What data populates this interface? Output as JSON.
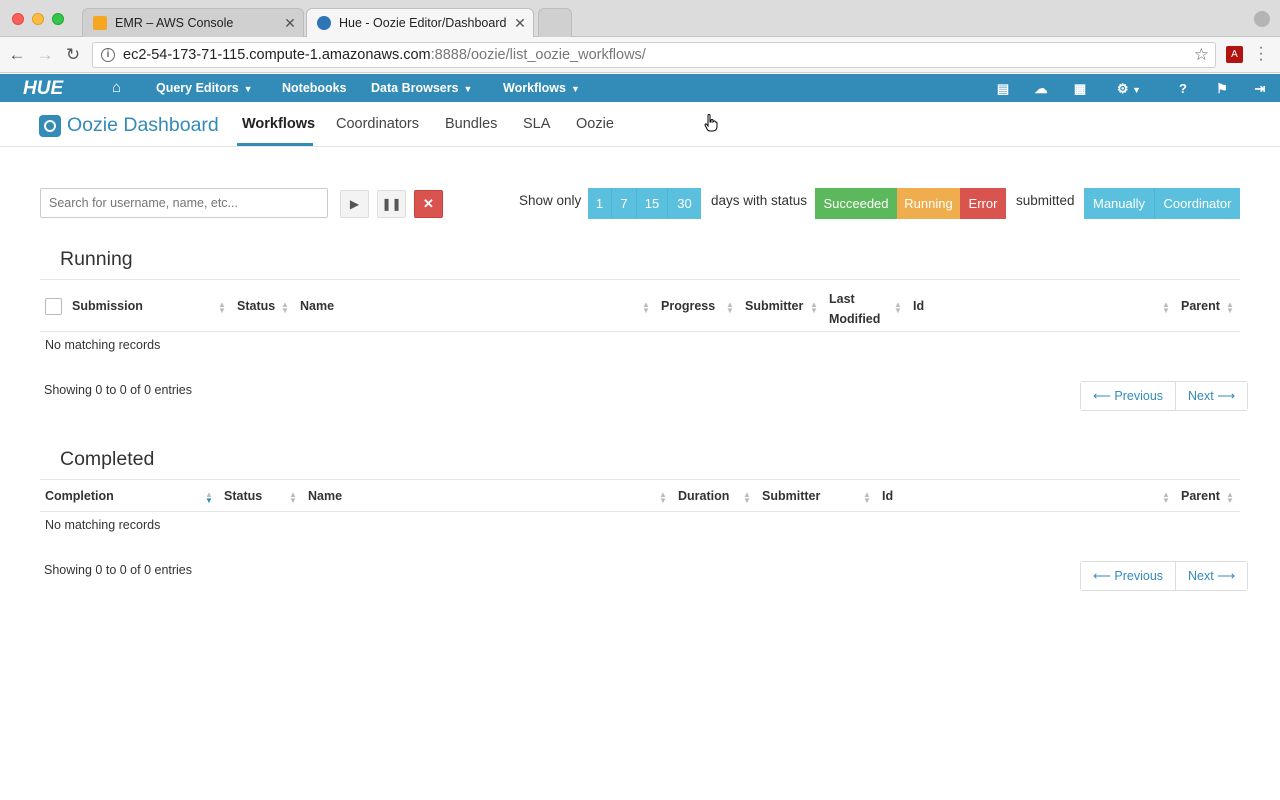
{
  "browser": {
    "tabs": [
      {
        "title": "EMR – AWS Console",
        "favicon": "aws-icon"
      },
      {
        "title": "Hue - Oozie Editor/Dashboard",
        "favicon": "hue-icon"
      }
    ],
    "url_host": "ec2-54-173-71-115.compute-1.amazonaws.com",
    "url_path": ":8888/oozie/list_oozie_workflows/"
  },
  "hue_nav": {
    "logo": "HUE",
    "items": [
      {
        "label": "Query Editors",
        "has_caret": true
      },
      {
        "label": "Notebooks",
        "has_caret": false
      },
      {
        "label": "Data Browsers",
        "has_caret": true
      },
      {
        "label": "Workflows",
        "has_caret": true
      }
    ]
  },
  "subnav": {
    "brand": "Oozie Dashboard",
    "tabs": [
      {
        "label": "Workflows",
        "active": true
      },
      {
        "label": "Coordinators",
        "active": false
      },
      {
        "label": "Bundles",
        "active": false
      },
      {
        "label": "SLA",
        "active": false
      },
      {
        "label": "Oozie",
        "active": false
      }
    ]
  },
  "filters": {
    "search_placeholder": "Search for username, name, etc...",
    "show_only": "Show only",
    "days": [
      "1",
      "7",
      "15",
      "30"
    ],
    "days_with_status": "days with status",
    "statuses": [
      "Succeeded",
      "Running",
      "Error"
    ],
    "submitted": "submitted",
    "submitted_options": [
      "Manually",
      "Coordinator"
    ]
  },
  "running": {
    "title": "Running",
    "columns": [
      "Submission",
      "Status",
      "Name",
      "Progress",
      "Submitter",
      "Last Modified",
      "Id",
      "Parent"
    ],
    "column_last_modified_line1": "Last",
    "column_last_modified_line2": "Modified",
    "empty": "No matching records",
    "info": "Showing 0 to 0 of 0 entries",
    "prev": "⟵ Previous",
    "next": "Next ⟶"
  },
  "completed": {
    "title": "Completed",
    "columns": [
      "Completion",
      "Status",
      "Name",
      "Duration",
      "Submitter",
      "Id",
      "Parent"
    ],
    "empty": "No matching records",
    "info": "Showing 0 to 0 of 0 entries",
    "prev": "⟵ Previous",
    "next": "Next ⟶"
  },
  "colors": {
    "hue_blue": "#338bb8",
    "info": "#5bc0de",
    "success": "#5cb85c",
    "warning": "#f0ad4e",
    "danger": "#d9534f"
  }
}
